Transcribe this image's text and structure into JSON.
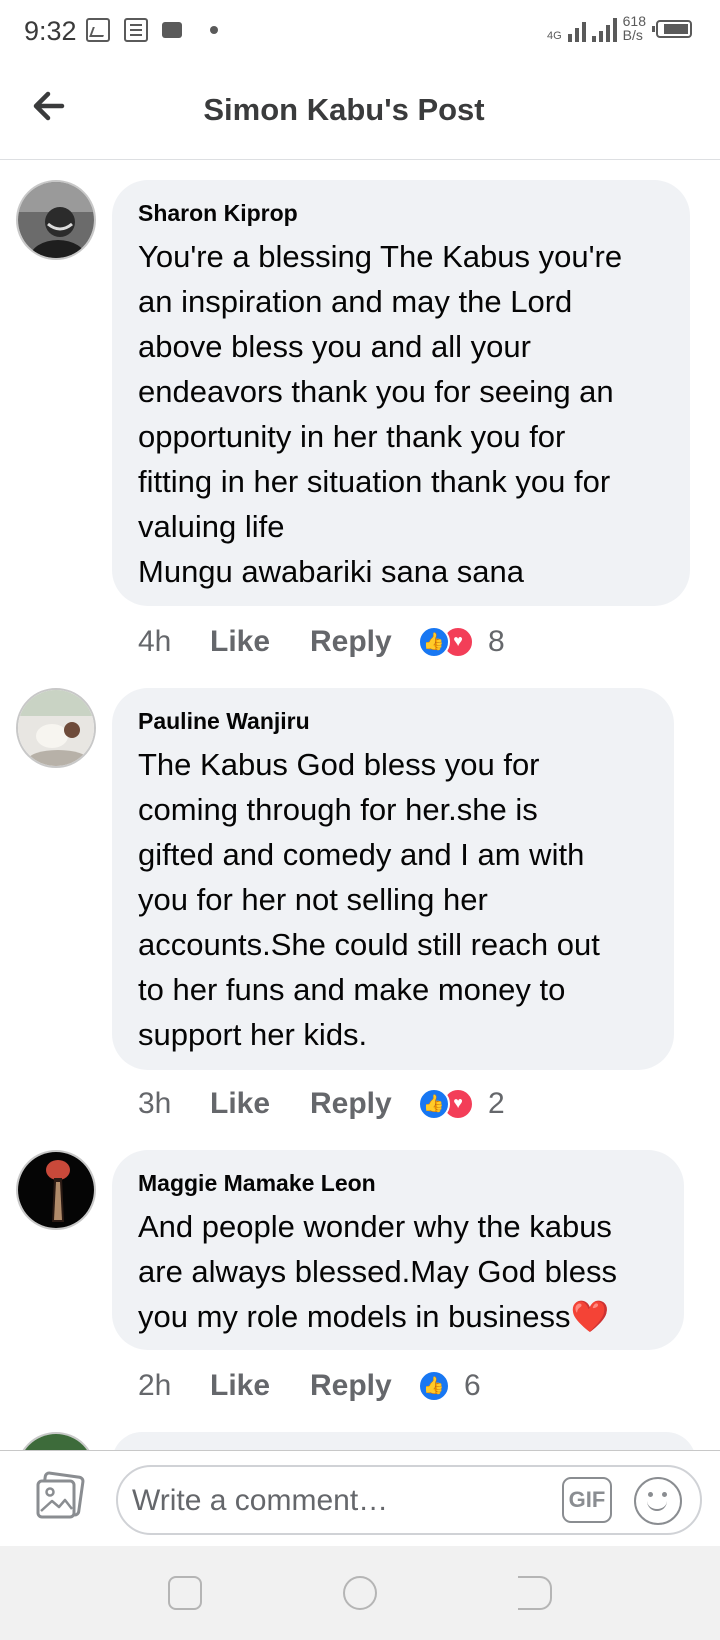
{
  "status_bar": {
    "time": "9:32",
    "network": "4G",
    "speed_value": "618",
    "speed_unit": "B/s"
  },
  "header": {
    "title": "Simon Kabu's Post",
    "back_icon": "arrow-left-icon"
  },
  "comments": [
    {
      "author": "Sharon Kiprop",
      "text": "You're a blessing The Kabus you're\nan inspiration and may the Lord\nabove bless you and all your\nendeavors thank you for seeing an\nopportunity in her thank you for\nfitting in her situation thank you for\nvaluing life\nMungu awabariki sana sana",
      "time": "4h",
      "like_label": "Like",
      "reply_label": "Reply",
      "reactions": [
        "like",
        "love"
      ],
      "reaction_count": "8"
    },
    {
      "author": "Pauline Wanjiru",
      "text": "The Kabus God bless you for\ncoming through for her.she is\ngifted and comedy and I am with\nyou for her not selling her\naccounts.She could still reach out\nto her funs and make money to\nsupport her kids.",
      "time": "3h",
      "like_label": "Like",
      "reply_label": "Reply",
      "reactions": [
        "like",
        "love"
      ],
      "reaction_count": "2"
    },
    {
      "author": "Maggie Mamake Leon",
      "text": "And people wonder why the kabus\nare always blessed.May God bless\nyou my role models in business❤️",
      "time": "2h",
      "like_label": "Like",
      "reply_label": "Reply",
      "reactions": [
        "like"
      ],
      "reaction_count": "6"
    }
  ],
  "composer": {
    "placeholder": "Write a comment…",
    "gif_label": "GIF"
  },
  "colors": {
    "like_blue": "#1877f2",
    "love_red": "#f33e58",
    "bubble_bg": "#f0f2f5"
  }
}
